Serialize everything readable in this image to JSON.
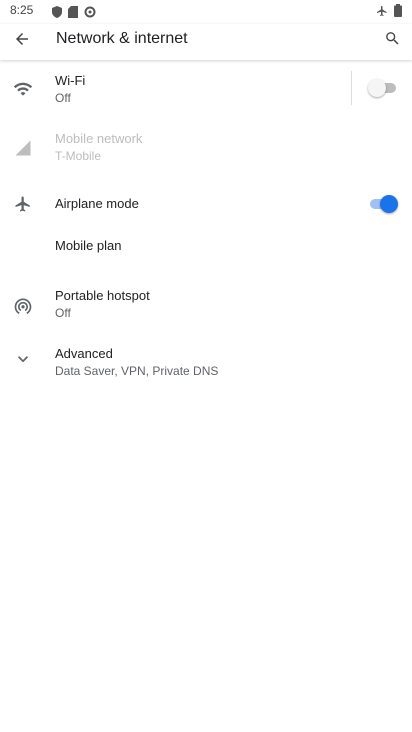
{
  "status_bar": {
    "time": "8:25",
    "icons": [
      "shield-icon",
      "sd-card-icon",
      "sync-icon",
      "airplane-icon",
      "battery-icon"
    ]
  },
  "app_bar": {
    "title": "Network & internet",
    "back_icon": "back-arrow-icon",
    "search_icon": "search-icon"
  },
  "items": {
    "wifi": {
      "title": "Wi-Fi",
      "subtitle": "Off",
      "icon": "wifi-icon",
      "toggle": false
    },
    "mobile_network": {
      "title": "Mobile network",
      "subtitle": "T-Mobile",
      "icon": "signal-icon",
      "disabled": true
    },
    "airplane_mode": {
      "title": "Airplane mode",
      "icon": "airplane-icon",
      "toggle": true
    },
    "mobile_plan": {
      "title": "Mobile plan"
    },
    "hotspot": {
      "title": "Portable hotspot",
      "subtitle": "Off",
      "icon": "hotspot-icon"
    },
    "advanced": {
      "title": "Advanced",
      "subtitle": "Data Saver, VPN, Private DNS",
      "icon": "chevron-down-icon"
    }
  },
  "colors": {
    "accent": "#1a73e8",
    "icon_gray": "#5f6368",
    "disabled": "#bdbdbd"
  }
}
